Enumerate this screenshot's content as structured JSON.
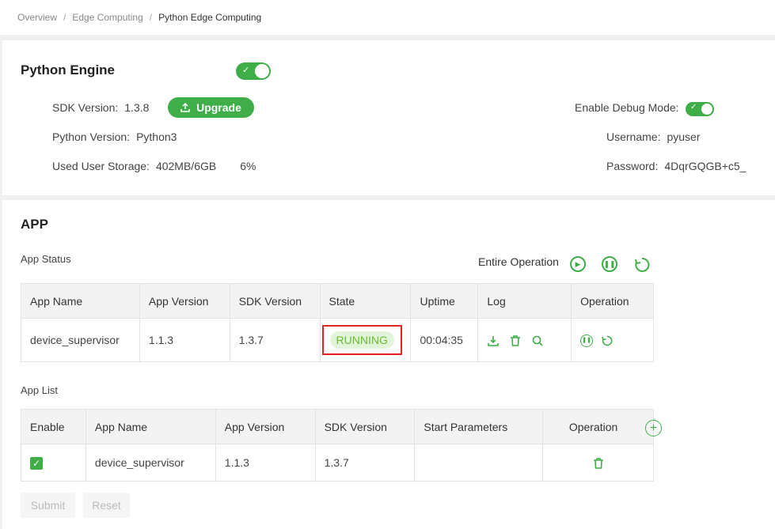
{
  "breadcrumb": {
    "items": [
      "Overview",
      "Edge Computing",
      "Python Edge Computing"
    ],
    "separator": "/"
  },
  "engine": {
    "title": "Python Engine",
    "enabled": true,
    "sdk_version_label": "SDK Version:",
    "sdk_version": "1.3.8",
    "upgrade_label": "Upgrade",
    "python_version_label": "Python Version:",
    "python_version": "Python3",
    "storage_label": "Used User Storage:",
    "storage_value": "402MB/6GB",
    "storage_percent": "6%",
    "debug_label": "Enable Debug Mode:",
    "debug_enabled": true,
    "username_label": "Username:",
    "username": "pyuser",
    "password_label": "Password:",
    "password": "4DqrGQGB+c5_"
  },
  "app": {
    "title": "APP",
    "status_label": "App Status",
    "entire_operation_label": "Entire Operation",
    "status_table": {
      "headers": [
        "App Name",
        "App Version",
        "SDK Version",
        "State",
        "Uptime",
        "Log",
        "Operation"
      ],
      "rows": [
        {
          "app_name": "device_supervisor",
          "app_version": "1.1.3",
          "sdk_version": "1.3.7",
          "state": "RUNNING",
          "uptime": "00:04:35"
        }
      ]
    },
    "list_label": "App List",
    "list_table": {
      "headers": [
        "Enable",
        "App Name",
        "App Version",
        "SDK Version",
        "Start Parameters",
        "Operation"
      ],
      "rows": [
        {
          "enabled": true,
          "app_name": "device_supervisor",
          "app_version": "1.1.3",
          "sdk_version": "1.3.7",
          "start_parameters": ""
        }
      ]
    },
    "submit_label": "Submit",
    "reset_label": "Reset"
  },
  "colors": {
    "accent": "#3fae49",
    "running_bg": "#e3f5d8",
    "running_text": "#68b93a",
    "highlight_border": "#e02424"
  },
  "icons": {
    "upgrade": "upload-icon",
    "start": "play-circle-icon",
    "pause": "pause-circle-icon",
    "restart": "restart-icon",
    "download": "download-icon",
    "delete": "trash-icon",
    "search": "search-icon",
    "add": "add-circle-icon"
  }
}
